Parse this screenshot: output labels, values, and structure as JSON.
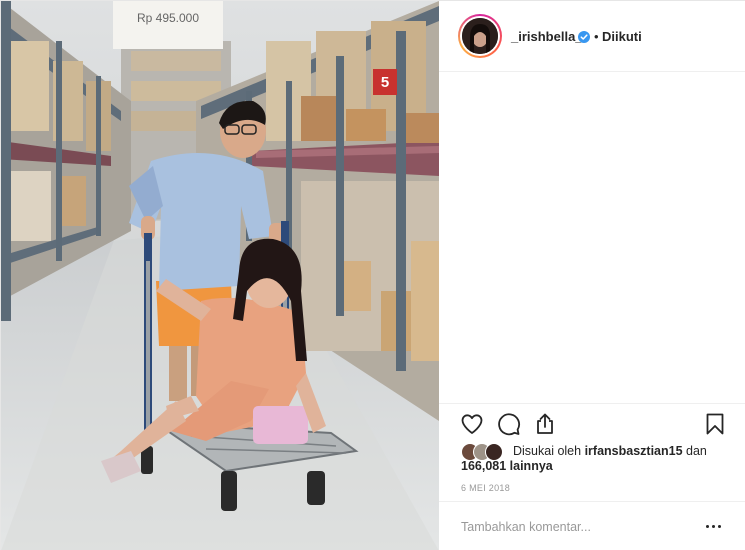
{
  "profile": {
    "username": "_irishbella_",
    "verified": true,
    "separator": "•",
    "follow_label": "Diikuti"
  },
  "photo": {
    "price_sign": "Rp 495.000",
    "aisle_number": "5"
  },
  "likes": {
    "prefix": "Disukai oleh ",
    "first_user": "irfansbasztian15",
    "and": " dan",
    "count": "166,081",
    "suffix": " lainnya"
  },
  "post": {
    "date": "6 MEI 2018"
  },
  "comment": {
    "placeholder": "Tambahkan komentar..."
  },
  "icons": {
    "like": "heart-icon",
    "comment": "speech-bubble-icon",
    "share": "share-icon",
    "save": "bookmark-icon",
    "more": "more-options-icon",
    "verified": "verified-badge-icon"
  },
  "colors": {
    "verified_blue": "#3897f0",
    "text": "#262626",
    "muted": "#999999"
  }
}
